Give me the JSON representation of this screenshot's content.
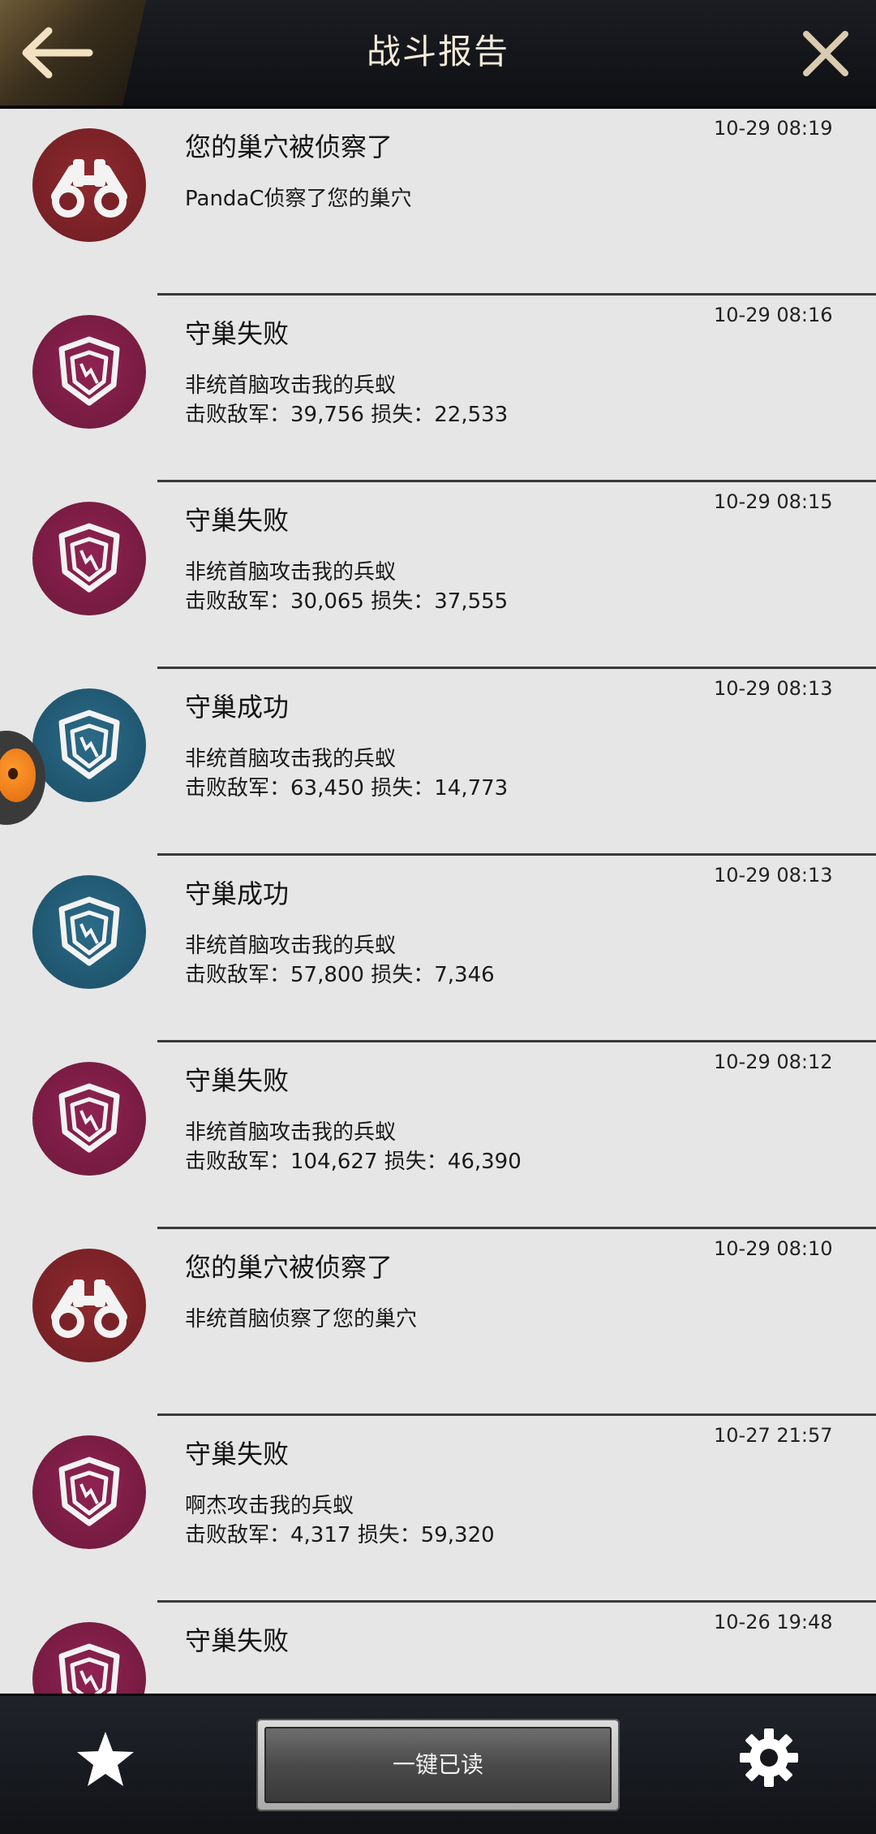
{
  "header": {
    "title": "战斗报告",
    "back_icon": "left-arrow-icon",
    "close_icon": "close-icon"
  },
  "colors": {
    "defeat": "#8f2352",
    "victory": "#2b6b88",
    "scout": "#8e2a2f"
  },
  "reports": [
    {
      "type": "scouted",
      "icon": "binoculars-icon",
      "title": "您的巢穴被侦察了",
      "time": "10-29 08:19",
      "line1": "PandaC侦察了您的巢穴",
      "line2": ""
    },
    {
      "type": "defeat",
      "icon": "shield-icon",
      "title": "守巢失败",
      "time": "10-29 08:16",
      "line1": "非统首脑攻击我的兵蚁",
      "line2": "击败敌军：39,756 损失：22,533"
    },
    {
      "type": "defeat",
      "icon": "shield-icon",
      "title": "守巢失败",
      "time": "10-29 08:15",
      "line1": "非统首脑攻击我的兵蚁",
      "line2": "击败敌军：30,065 损失：37,555"
    },
    {
      "type": "victory",
      "icon": "shield-icon",
      "title": "守巢成功",
      "time": "10-29 08:13",
      "line1": "非统首脑攻击我的兵蚁",
      "line2": "击败敌军：63,450 损失：14,773"
    },
    {
      "type": "victory",
      "icon": "shield-icon",
      "title": "守巢成功",
      "time": "10-29 08:13",
      "line1": "非统首脑攻击我的兵蚁",
      "line2": "击败敌军：57,800 损失：7,346"
    },
    {
      "type": "defeat",
      "icon": "shield-icon",
      "title": "守巢失败",
      "time": "10-29 08:12",
      "line1": "非统首脑攻击我的兵蚁",
      "line2": "击败敌军：104,627 损失：46,390"
    },
    {
      "type": "scouted",
      "icon": "binoculars-icon",
      "title": "您的巢穴被侦察了",
      "time": "10-29 08:10",
      "line1": "非统首脑侦察了您的巢穴",
      "line2": ""
    },
    {
      "type": "defeat",
      "icon": "shield-icon",
      "title": "守巢失败",
      "time": "10-27 21:57",
      "line1": "啊杰攻击我的兵蚁",
      "line2": "击败敌军：4,317 损失：59,320"
    },
    {
      "type": "defeat",
      "icon": "shield-icon",
      "title": "守巢失败",
      "time": "10-26 19:48",
      "line1": "",
      "line2": ""
    }
  ],
  "bottom": {
    "read_all_label": "一键已读",
    "favorites_icon": "star-icon",
    "settings_icon": "gear-icon"
  }
}
